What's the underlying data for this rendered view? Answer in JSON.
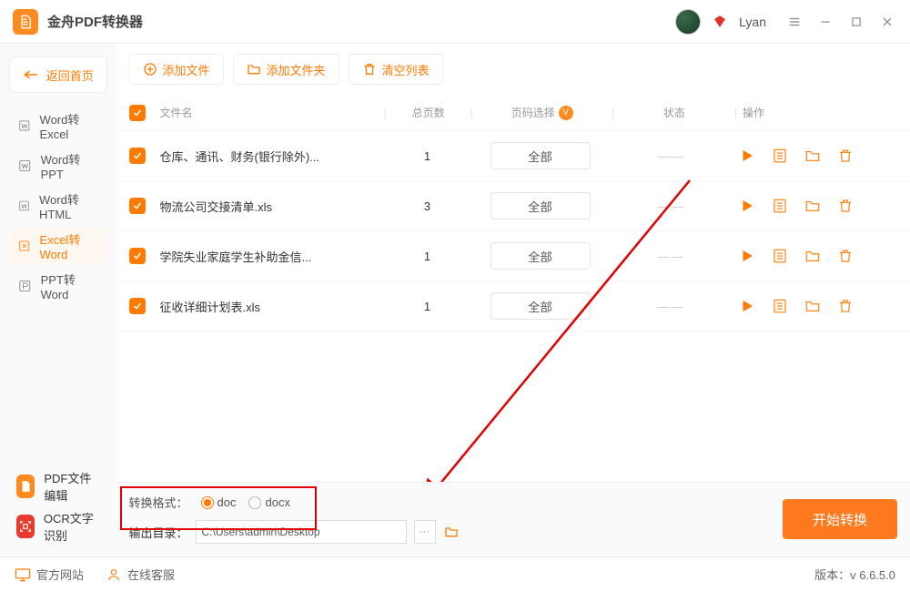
{
  "app_title": "金舟PDF转换器",
  "username": "Lyan",
  "home_button": "返回首页",
  "sidebar": {
    "items": [
      {
        "label": "Word转Excel"
      },
      {
        "label": "Word转PPT"
      },
      {
        "label": "Word转HTML"
      },
      {
        "label": "Excel转Word"
      },
      {
        "label": "PPT转Word"
      }
    ]
  },
  "features": {
    "pdf_edit": "PDF文件编辑",
    "ocr": "OCR文字识别"
  },
  "toolbar": {
    "add_file": "添加文件",
    "add_folder": "添加文件夹",
    "clear_list": "清空列表"
  },
  "table": {
    "headers": {
      "filename": "文件名",
      "pages": "总页数",
      "page_select": "页码选择",
      "status": "状态",
      "ops": "操作"
    },
    "rows": [
      {
        "name": "仓库、通讯、财务(银行除外)...",
        "pages": "1",
        "select": "全部",
        "status": "——"
      },
      {
        "name": "物流公司交接清单.xls",
        "pages": "3",
        "select": "全部",
        "status": "——"
      },
      {
        "name": "学院失业家庭学生补助金信...",
        "pages": "1",
        "select": "全部",
        "status": "——"
      },
      {
        "name": "征收详细计划表.xls",
        "pages": "1",
        "select": "全部",
        "status": "——"
      }
    ]
  },
  "format": {
    "label": "转换格式：",
    "opt1": "doc",
    "opt2": "docx"
  },
  "output": {
    "label": "输出目录：",
    "path": "C:\\Users\\admin\\Desktop"
  },
  "start_button": "开始转换",
  "footer": {
    "website": "官方网站",
    "support": "在线客服",
    "version_label": "版本：",
    "version": "v 6.6.5.0"
  }
}
